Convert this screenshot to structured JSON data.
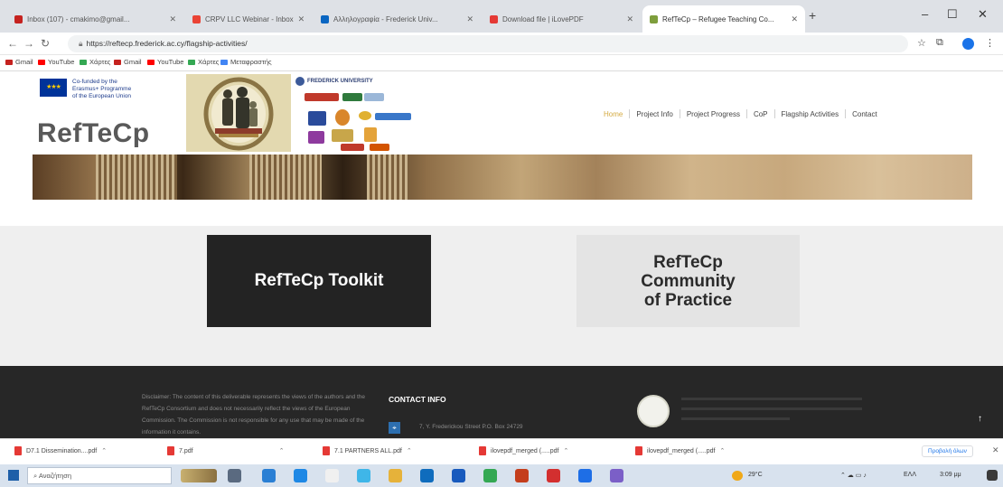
{
  "browser": {
    "tabs": [
      {
        "title": "Inbox (107) - cmakimo@gmail...",
        "color": "#c5221f"
      },
      {
        "title": "CRPV LLC Webinar - Inbox",
        "color": "#ea4335"
      },
      {
        "title": "Αλληλογραφία - Frederick Univ...",
        "color": "#0a66c2"
      },
      {
        "title": "Download file | iLovePDF",
        "color": "#e53935"
      },
      {
        "title": "RefTeCp – Refugee Teaching Co...",
        "color": "#7e9e3c"
      }
    ],
    "url": "https://reftecp.frederick.ac.cy/flagship-activities/",
    "bookmarks": [
      {
        "label": "Gmail",
        "color": "#c5221f"
      },
      {
        "label": "YouTube",
        "color": "#ff0000"
      },
      {
        "label": "Χάρτες",
        "color": "#34a853"
      },
      {
        "label": "Gmail",
        "color": "#c5221f"
      },
      {
        "label": "YouTube",
        "color": "#ff0000"
      },
      {
        "label": "Χάρτες",
        "color": "#34a853"
      },
      {
        "label": "Μεταφραστής",
        "color": "#4285f4"
      }
    ]
  },
  "site": {
    "eu_text": [
      "Co-funded by the",
      "Erasmus+ Programme",
      "of the European Union"
    ],
    "brand": "RefTeCp",
    "partner_name": "FREDERICK UNIVERSITY",
    "nav": [
      {
        "label": "Home",
        "active": true
      },
      {
        "label": "Project Info",
        "active": false
      },
      {
        "label": "Project Progress",
        "active": false
      },
      {
        "label": "CoP",
        "active": false
      },
      {
        "label": "Flagship Activities",
        "active": false
      },
      {
        "label": "Contact",
        "active": false
      }
    ]
  },
  "cards": {
    "toolkit": "RefTeCp Toolkit",
    "community": "RefTeCp\nCommunity\nof Practice"
  },
  "footer": {
    "disclaimer": "Disclaimer: The content of this deliverable represents the views of the authors and the RefTeCp Consortium and does not necessarily reflect the views of the European Commission. The Commission is not responsible for any use that may be made of the information it contains.",
    "contact_heading": "CONTACT INFO",
    "address": "7, Y. Frederickou Street P.O. Box 24729",
    "to_top": "↑"
  },
  "downloads": [
    "D7.1 Dissemination....pdf",
    "7.pdf",
    "7.1 PARTNERS ALL.pdf",
    "ilovepdf_merged (.....pdf",
    "ilovepdf_merged (.....pdf"
  ],
  "downloads_show_all": "Προβολή όλων",
  "taskbar": {
    "search_placeholder": "Αναζήτηση",
    "weather": "29°C",
    "language": "ΕΛΛ",
    "time": "3:09 μμ"
  }
}
